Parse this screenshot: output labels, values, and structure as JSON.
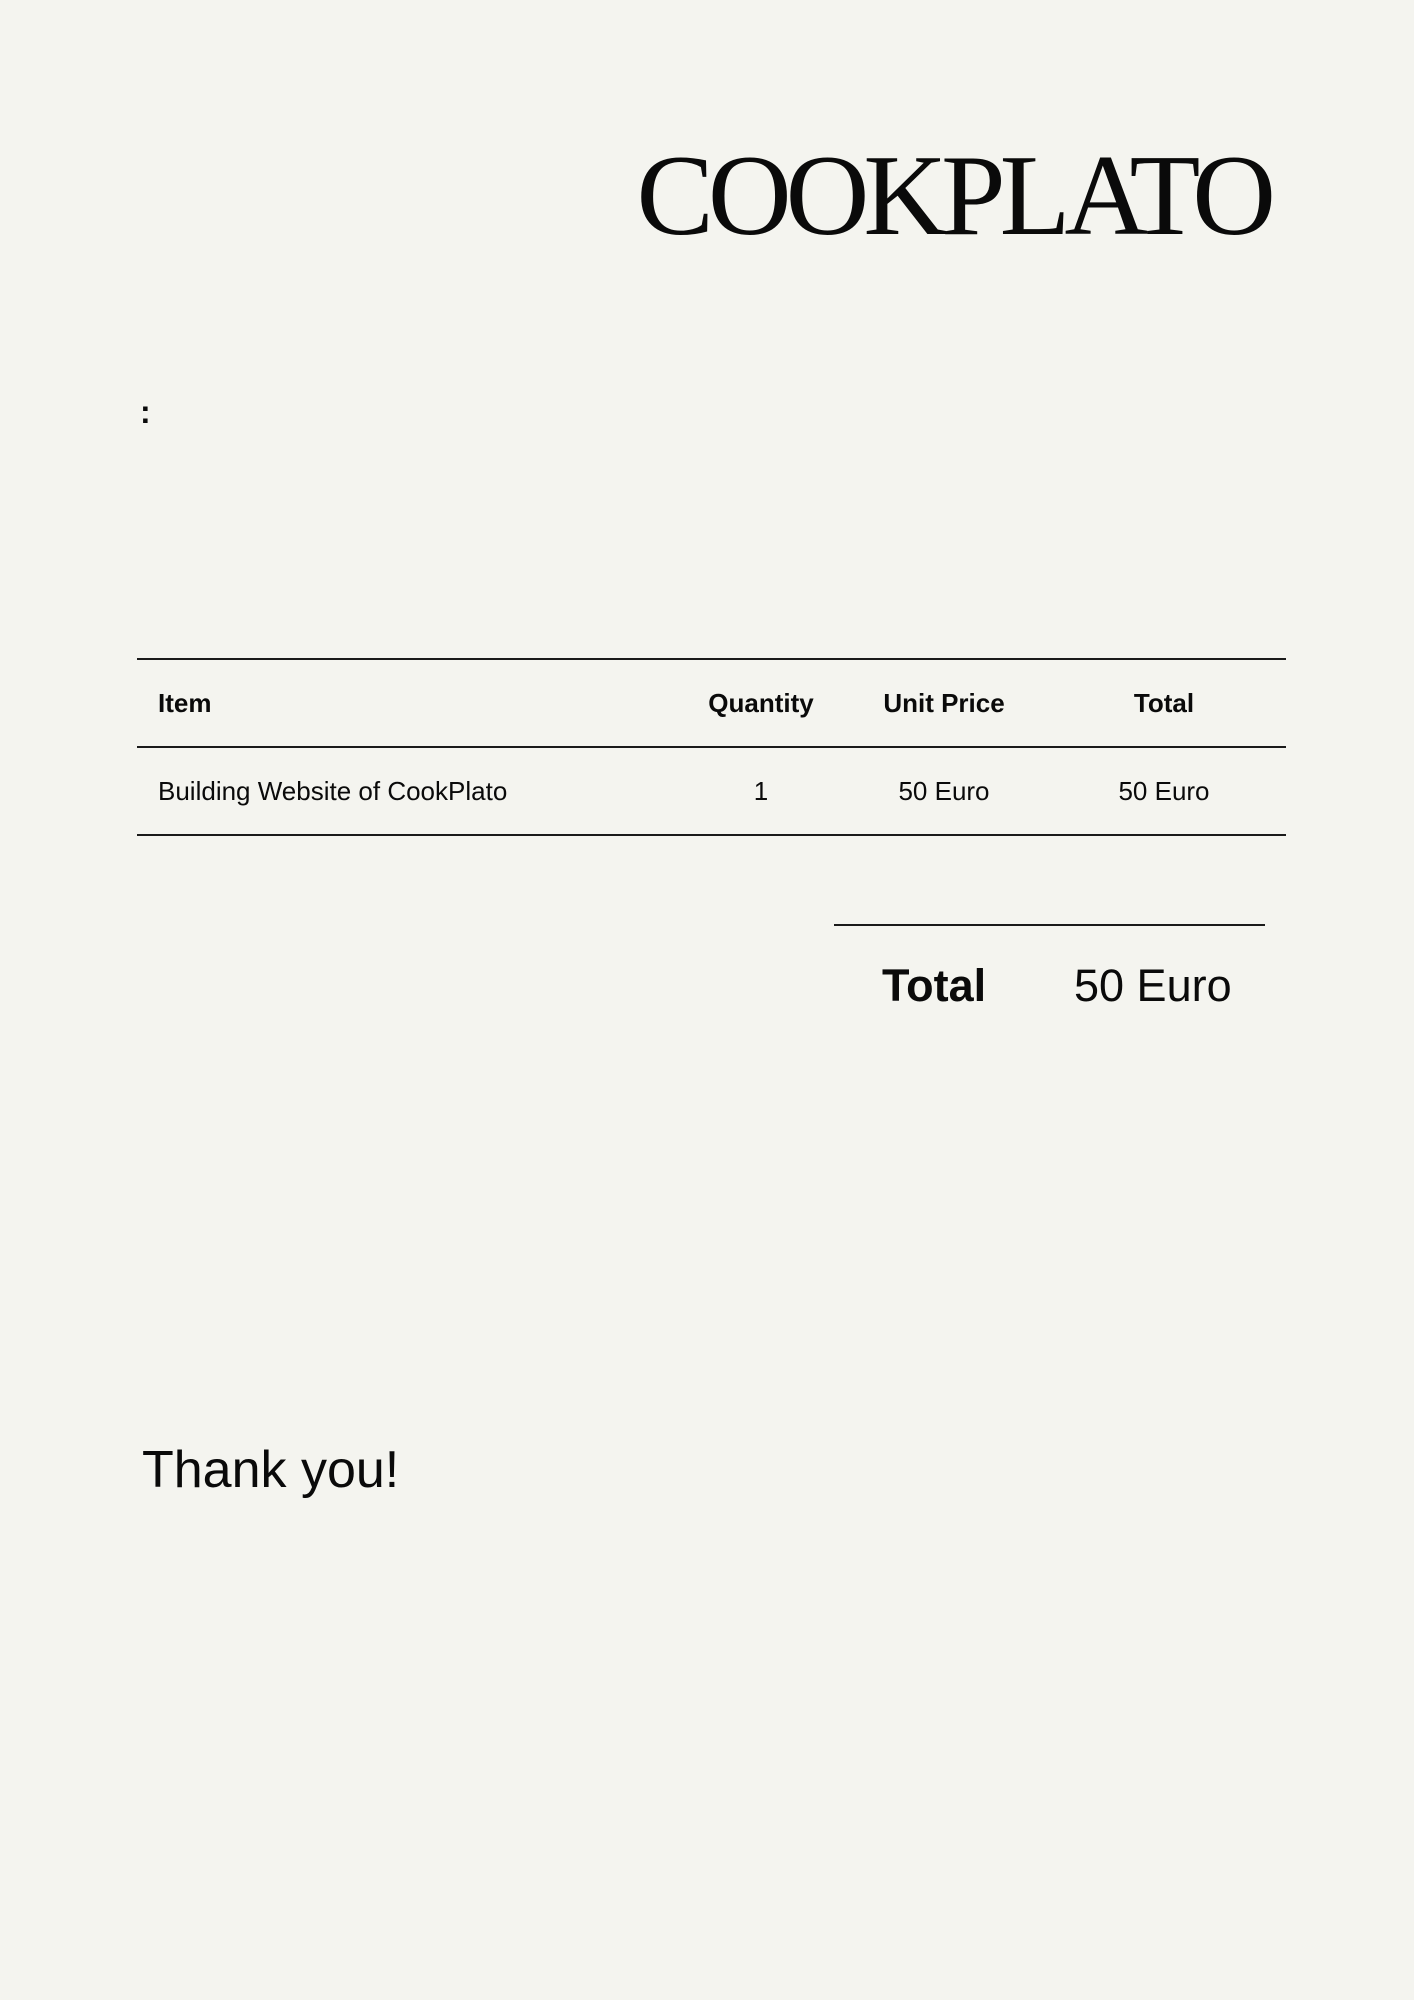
{
  "brand": {
    "name": "COOKPLATO"
  },
  "header": {
    "colon": ":"
  },
  "table": {
    "columns": [
      "Item",
      "Quantity",
      "Unit Price",
      "Total"
    ],
    "rows": [
      {
        "item": "Building Website of CookPlato",
        "quantity": "1",
        "unit_price": "50 Euro",
        "total": "50 Euro"
      }
    ]
  },
  "summary": {
    "label": "Total",
    "value": "50 Euro"
  },
  "footer": {
    "thanks": "Thank you!"
  }
}
